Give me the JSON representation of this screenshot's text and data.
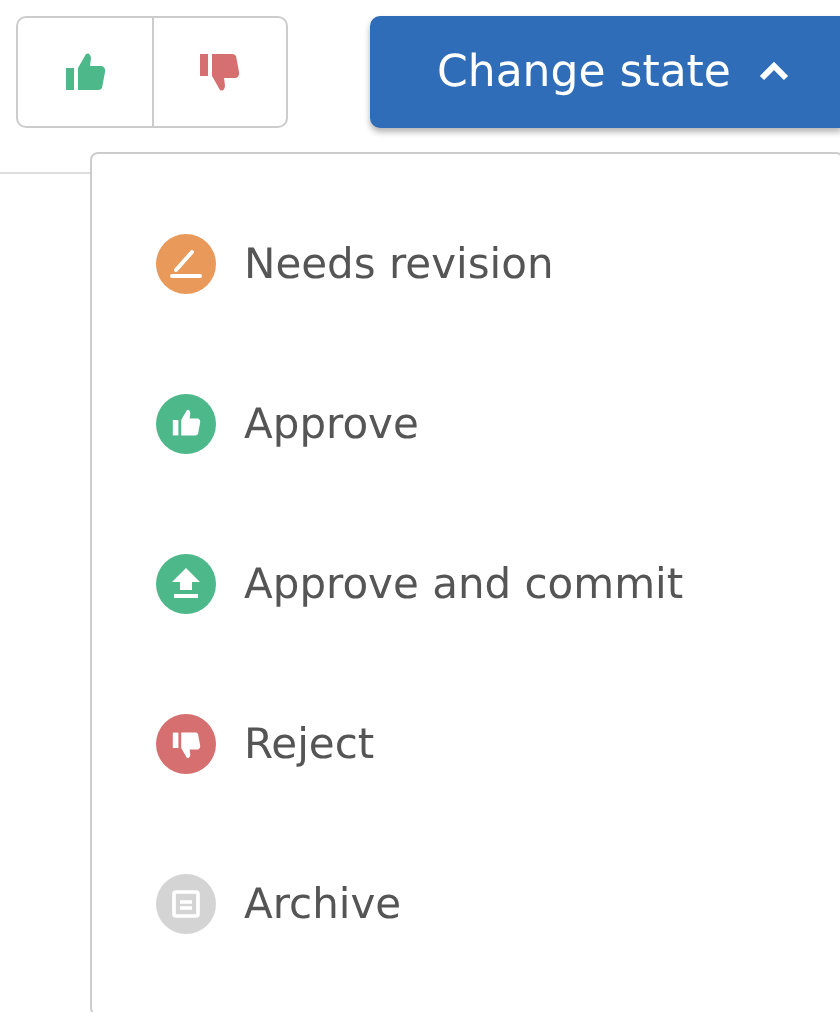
{
  "state_button": {
    "label": "Change state",
    "expanded": true
  },
  "menu": [
    {
      "label": "Needs revision",
      "kind": "revision",
      "color": "#e9995a"
    },
    {
      "label": "Approve",
      "kind": "approve",
      "color": "#4db88a"
    },
    {
      "label": "Approve and commit",
      "kind": "commit",
      "color": "#4db88a"
    },
    {
      "label": "Reject",
      "kind": "reject",
      "color": "#d66f6f"
    },
    {
      "label": "Archive",
      "kind": "archive",
      "color": "#d4d4d4"
    }
  ]
}
